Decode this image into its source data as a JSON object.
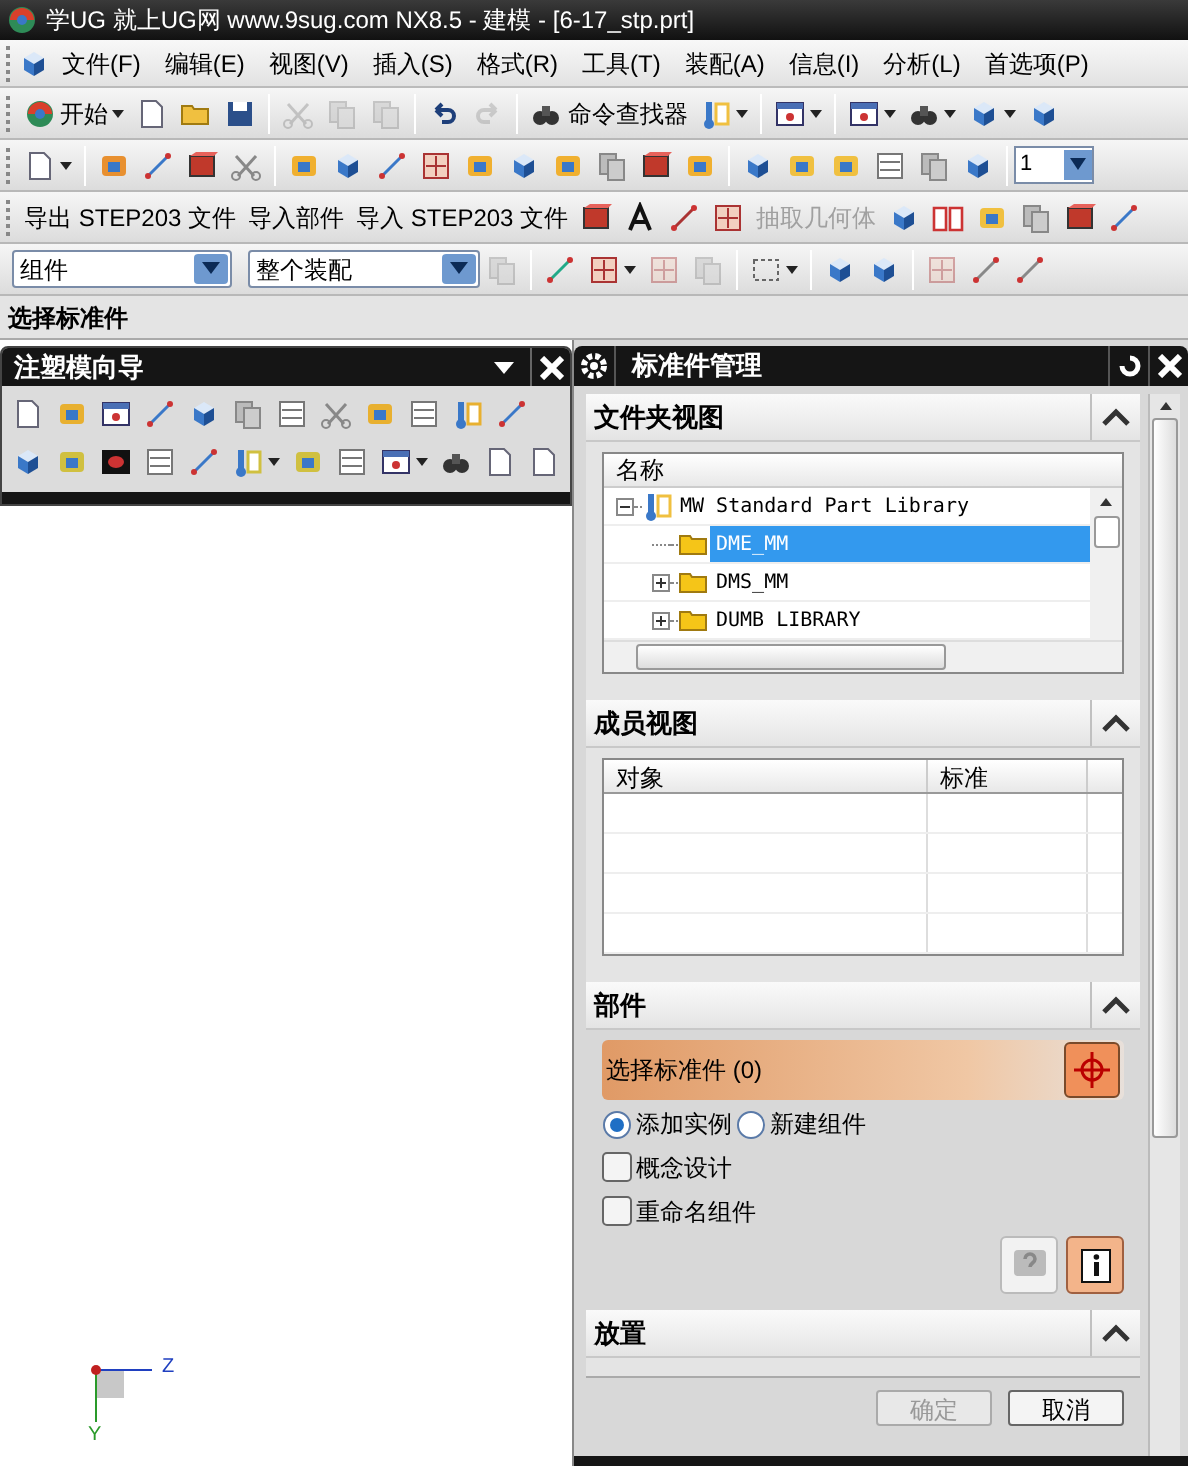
{
  "window": {
    "title": "学UG 就上UG网  www.9sug.com NX8.5 - 建模 - [6-17_stp.prt]"
  },
  "menu_bar": [
    {
      "label": "文件(F)"
    },
    {
      "label": "编辑(E)"
    },
    {
      "label": "视图(V)"
    },
    {
      "label": "插入(S)"
    },
    {
      "label": "格式(R)"
    },
    {
      "label": "工具(T)"
    },
    {
      "label": "装配(A)"
    },
    {
      "label": "信息(I)"
    },
    {
      "label": "分析(L)"
    },
    {
      "label": "首选项(P)"
    }
  ],
  "toolbar_standard": {
    "start_label": "开始",
    "command_finder_label": "命令查找器"
  },
  "toolbar_view": {
    "layer_value": "1"
  },
  "toolbar_exchange": [
    {
      "label": "导出 STEP203 文件",
      "disabled": false
    },
    {
      "label": "导入部件",
      "disabled": false
    },
    {
      "label": "导入 STEP203 文件",
      "disabled": false
    },
    {
      "label": "抽取几何体",
      "disabled": true
    }
  ],
  "selection_bar": {
    "filter_value": "组件",
    "scope_value": "整个装配"
  },
  "cue_line": "选择标准件",
  "navigator": {
    "title": "注塑模向导"
  },
  "graphics": {
    "axis_labels": [
      "Z",
      "Y"
    ]
  },
  "standard_part_manager": {
    "title": "标准件管理",
    "folder_view": {
      "heading": "文件夹视图",
      "column": "名称",
      "tree": [
        {
          "label": "MW Standard Part Library",
          "kind": "expanded",
          "selected": false,
          "children": [
            {
              "label": "DME_MM",
              "kind": "leaf",
              "selected": true
            },
            {
              "label": "DMS_MM",
              "kind": "collapsed",
              "selected": false
            },
            {
              "label": "DUMB LIBRARY",
              "kind": "collapsed",
              "selected": false
            }
          ]
        }
      ]
    },
    "member_view": {
      "heading": "成员视图",
      "columns": [
        "对象",
        "标准"
      ]
    },
    "part": {
      "heading": "部件",
      "select_label": "选择标准件 (0)",
      "radios": [
        {
          "label": "添加实例",
          "selected": true
        },
        {
          "label": "新建组件",
          "selected": false
        }
      ],
      "checkboxes": [
        {
          "label": "概念设计",
          "checked": false
        },
        {
          "label": "重命名组件",
          "checked": false
        }
      ]
    },
    "placement": {
      "heading": "放置"
    },
    "buttons": [
      {
        "label": "确定",
        "disabled": true
      },
      {
        "label": "取消",
        "disabled": false
      }
    ]
  }
}
